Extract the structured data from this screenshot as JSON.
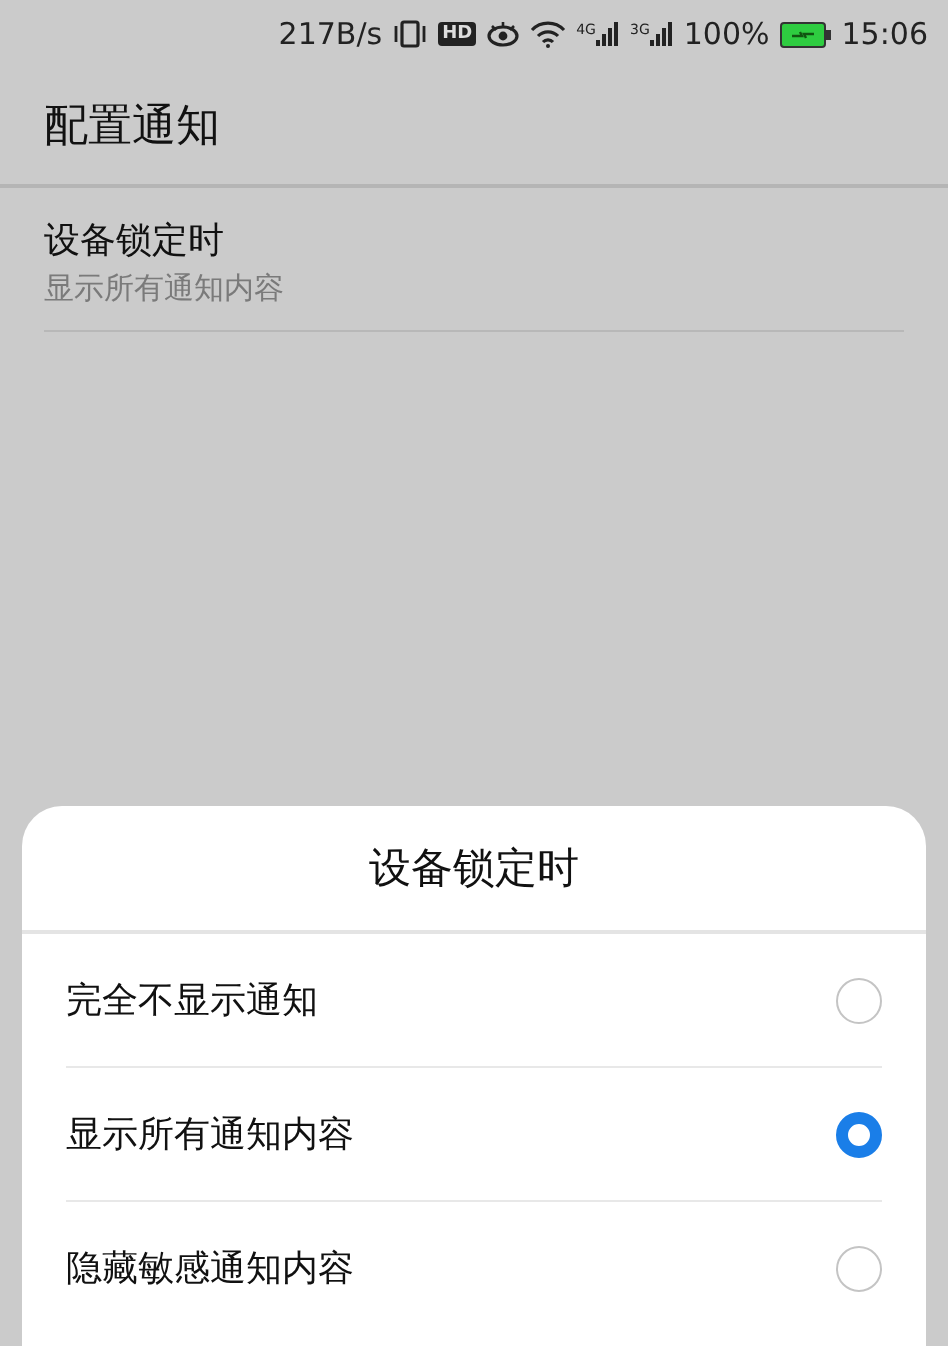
{
  "status_bar": {
    "speed": "217B/s",
    "hd": "HD",
    "net1": "4G",
    "net2": "3G",
    "battery": "100%",
    "time": "15:06"
  },
  "header": {
    "title": "配置通知"
  },
  "setting": {
    "title": "设备锁定时",
    "value": "显示所有通知内容"
  },
  "dialog": {
    "title": "设备锁定时",
    "options": [
      {
        "label": "完全不显示通知",
        "selected": false
      },
      {
        "label": "显示所有通知内容",
        "selected": true
      },
      {
        "label": "隐藏敏感通知内容",
        "selected": false
      }
    ]
  }
}
